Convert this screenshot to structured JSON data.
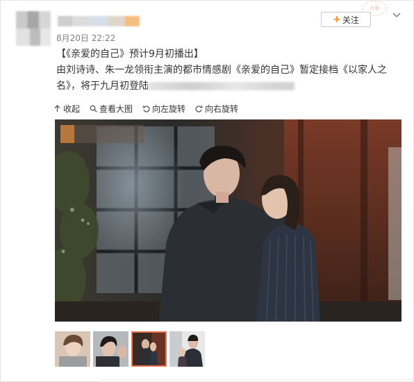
{
  "post": {
    "time": "8月20日 22:22",
    "follow_label": "关注",
    "follow_plus": "+",
    "watermark": "大萌",
    "title_line": "【《亲爱的自己》预计9月初播出】",
    "body_line1": "由刘诗诗、朱一龙领衔主演的都市情感剧《亲爱的自己》暂定接档《以家人之",
    "body_line2": "名》，将于九月初登陆"
  },
  "actions": [
    {
      "icon": "collapse-icon",
      "label": "收起"
    },
    {
      "icon": "magnifier-icon",
      "label": "查看大图"
    },
    {
      "icon": "rotate-left-icon",
      "label": "向左旋转"
    },
    {
      "icon": "rotate-right-icon",
      "label": "向右旋转"
    }
  ],
  "colors": {
    "accent": "#ff8200",
    "thumb_active": "#eb7350",
    "text": "#333333",
    "muted": "#808080"
  },
  "thumbnails": [
    {
      "active": false
    },
    {
      "active": false
    },
    {
      "active": true
    },
    {
      "active": false
    }
  ]
}
